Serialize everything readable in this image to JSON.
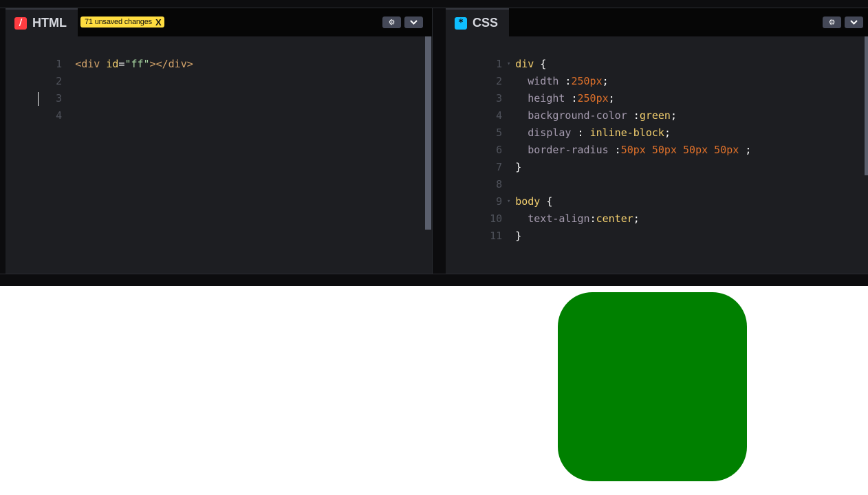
{
  "html_panel": {
    "title": "HTML",
    "icon": "/",
    "badge": "71 unsaved changes",
    "badge_close": "X",
    "lines": [
      {
        "n": "1"
      },
      {
        "n": "2"
      },
      {
        "n": "3"
      },
      {
        "n": "4"
      }
    ],
    "code_line1": {
      "open": "<div ",
      "attr": "id",
      "eq": "=",
      "val": "\"ff\"",
      "close": "></div>"
    }
  },
  "css_panel": {
    "title": "CSS",
    "icon": "*",
    "lines": [
      {
        "n": "1",
        "sel": "div",
        "brace": " {"
      },
      {
        "n": "2",
        "prop": "width",
        "sep": " :",
        "val": "250px",
        "end": ";"
      },
      {
        "n": "3",
        "prop": "height",
        "sep": " :",
        "val": "250px",
        "end": ";"
      },
      {
        "n": "4",
        "prop": "background-color",
        "sep": " :",
        "val": "green",
        "end": ";"
      },
      {
        "n": "5",
        "prop": "display",
        "sep": " : ",
        "val": "inline-block",
        "end": ";"
      },
      {
        "n": "6",
        "prop": "border-radius",
        "sep": " :",
        "val": "50px 50px 50px 50px",
        "end": " ;"
      },
      {
        "n": "7",
        "brace": "}"
      },
      {
        "n": "8"
      },
      {
        "n": "9",
        "sel": "body",
        "brace": " {"
      },
      {
        "n": "10",
        "prop": "text-align",
        "sep": ":",
        "val": "center",
        "end": ";"
      },
      {
        "n": "11",
        "brace": "}"
      }
    ]
  },
  "icons": {
    "settings": "gear-icon",
    "collapse": "chevron-down-icon"
  },
  "colors": {
    "preview_box": "#008000",
    "badge": "#ffdd40",
    "html_icon": "#ff3c41",
    "css_icon": "#0ebeff"
  }
}
